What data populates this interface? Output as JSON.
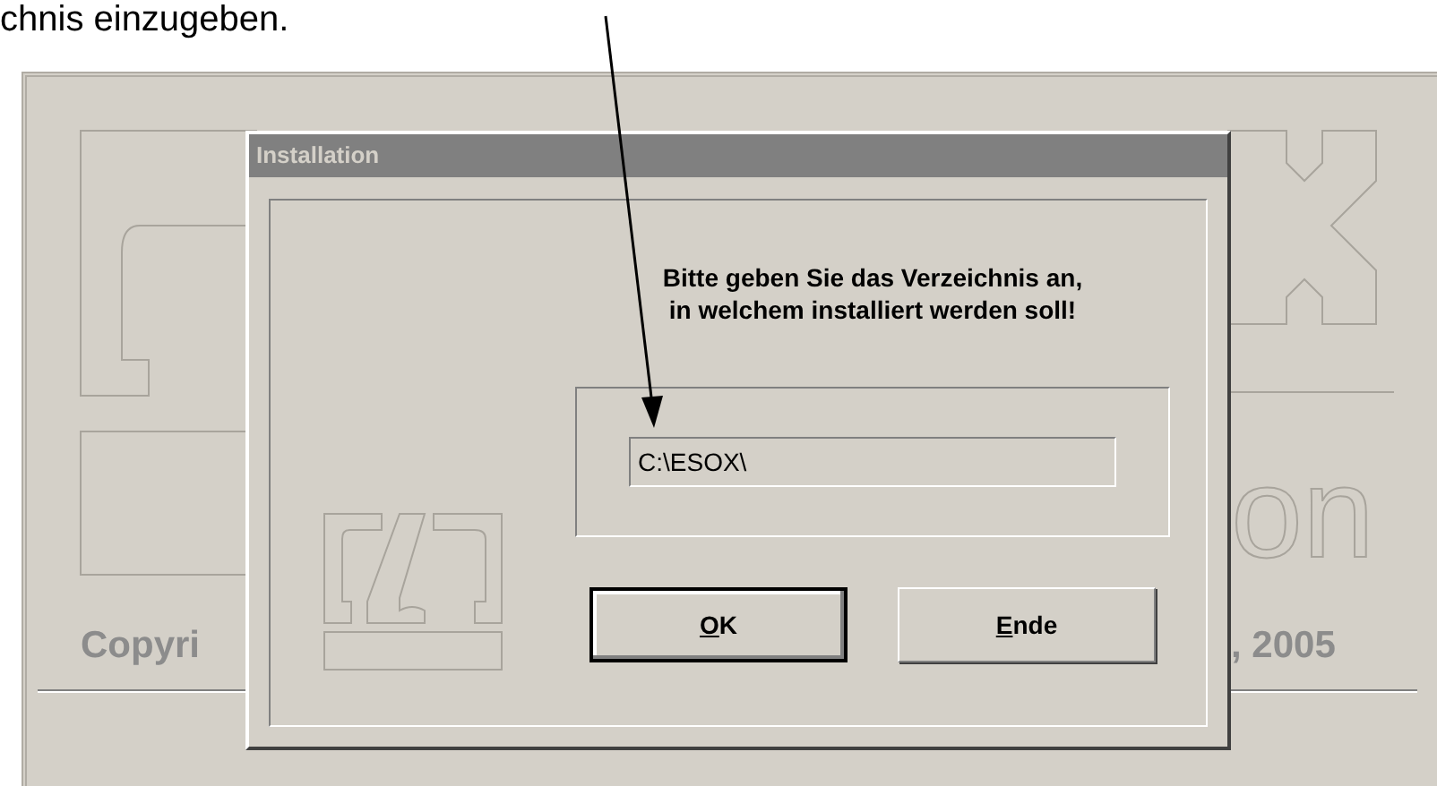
{
  "annotation": {
    "text": "chnis einzugeben."
  },
  "splash": {
    "big_text": "on",
    "left_text": "Copyri",
    "right_text": ", 2005"
  },
  "dialog": {
    "title": "Installation",
    "message": [
      "Bitte geben Sie das Verzeichnis an,",
      "in welchem installiert werden soll!"
    ],
    "path_field": {
      "value": "C:\\ESOX\\"
    },
    "buttons": [
      {
        "label": "OK",
        "default": true
      },
      {
        "label": "Ende",
        "default": false
      }
    ]
  }
}
